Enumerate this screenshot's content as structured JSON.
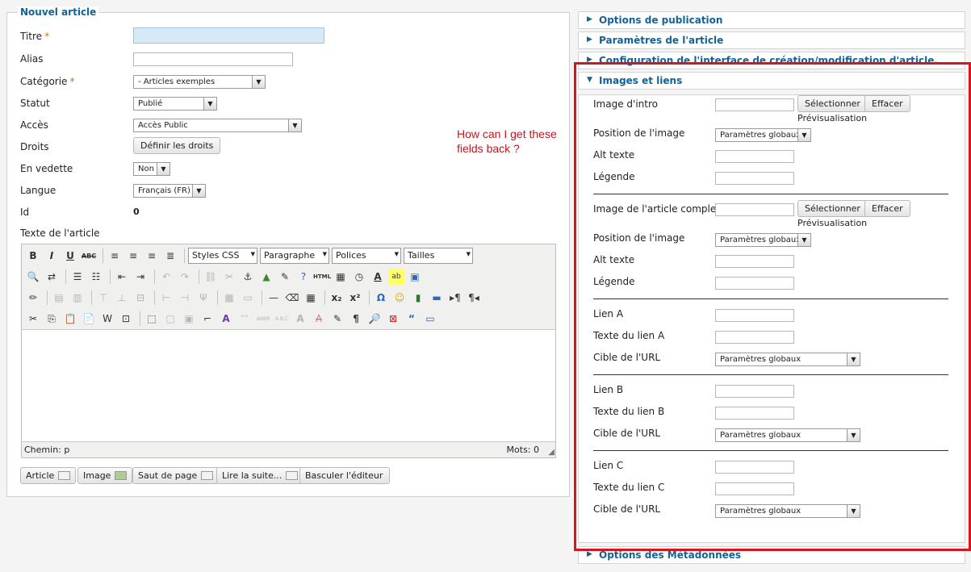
{
  "form": {
    "legend": "Nouvel article",
    "fields": {
      "titre": "Titre",
      "alias": "Alias",
      "categorie": "Catégorie",
      "statut": "Statut",
      "acces": "Accès",
      "droits": "Droits",
      "vedette": "En vedette",
      "langue": "Langue",
      "id": "Id",
      "texte": "Texte de l'article"
    },
    "required_mark": "*",
    "values": {
      "categorie": "- Articles exemples",
      "statut": "Publié",
      "acces": "Accès Public",
      "vedette": "Non",
      "langue": "Français (FR)",
      "id": "0"
    },
    "droits_button": "Définir les droits"
  },
  "editor": {
    "selects": [
      "Styles CSS",
      "Paragraphe",
      "Polices",
      "Tailles"
    ],
    "status_path": "Chemin: p",
    "word_count": "Mots: 0",
    "buttons": [
      "Article",
      "Image",
      "Saut de page",
      "Lire la suite...",
      "Basculer l'éditeur"
    ]
  },
  "question": "How can I get these\nfields back ?",
  "accordion": {
    "items": [
      "Options de publication",
      "Paramètres de l'article",
      "Configuration de l'interface de création/modification d'article.",
      "Images et liens",
      "Options des Métadonnées"
    ]
  },
  "images_panel": {
    "image_intro": "Image d'intro",
    "image_full": "Image de l'article complet",
    "position": "Position de l'image",
    "alt": "Alt texte",
    "legende": "Légende",
    "select_btn": "Sélectionner",
    "clear_btn": "Effacer",
    "preview": "Prévisualisation",
    "global": "Paramètres globaux",
    "lien_a": "Lien A",
    "texte_lien_a": "Texte du lien A",
    "lien_b": "Lien B",
    "texte_lien_b": "Texte du lien B",
    "lien_c": "Lien C",
    "texte_lien_c": "Texte du lien C",
    "cible": "Cible de l'URL"
  },
  "colors": {
    "accent": "#146295",
    "annotation": "#d8141c",
    "required": "#e07000"
  }
}
